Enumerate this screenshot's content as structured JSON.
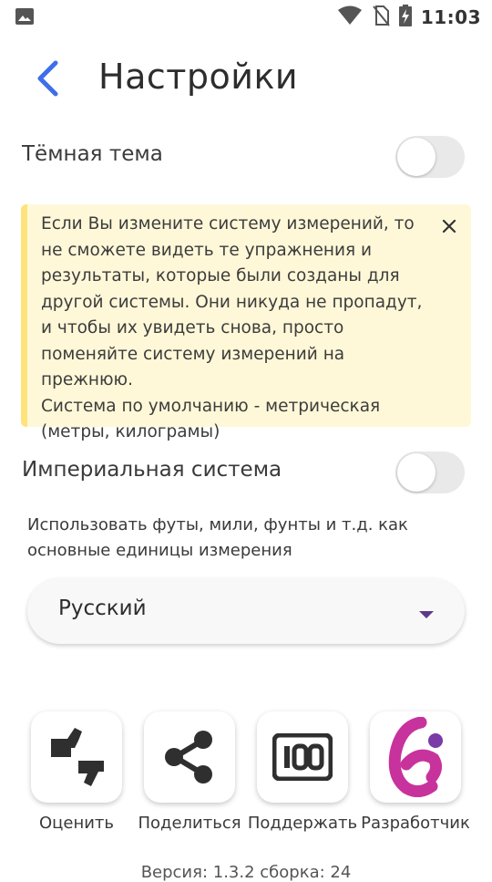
{
  "status_bar": {
    "time": "11:03",
    "icons": [
      "image-icon",
      "wifi-icon",
      "no-sim-icon",
      "battery-charging-icon"
    ]
  },
  "header": {
    "back_icon": "chevron-left-icon",
    "title": "Настройки"
  },
  "dark_theme": {
    "label": "Тёмная тема",
    "enabled": false
  },
  "notice": {
    "text": "Если Вы измените систему измерений, то не сможете видеть те упражнения и результаты, которые были созданы для другой системы. Они никуда не пропадут, и чтобы их увидеть снова, просто поменяйте систему измерений на прежнюю.\nСистема по умолчанию - метрическая (метры, килограмы)",
    "close_icon": "close-icon"
  },
  "imperial": {
    "label": "Империальная система",
    "enabled": false,
    "description": "Использовать футы, мили, фунты и т.д. как основные единицы измерения"
  },
  "language": {
    "selected": "Русский"
  },
  "actions": [
    {
      "label": "Оценить",
      "icon": "thumbs-icon"
    },
    {
      "label": "Поделиться",
      "icon": "share-icon"
    },
    {
      "label": "Поддержать",
      "icon": "support-100-icon"
    },
    {
      "label": "Разработчик",
      "icon": "developer-logo-icon"
    }
  ],
  "version": "Версия: 1.3.2 сборка: 24",
  "colors": {
    "accent_blue": "#3f6fe8",
    "notice_bg": "#fff8d8",
    "notice_bar": "#ffe27a",
    "dropdown_arrow": "#5e3a8a",
    "developer_logo": "#c8329c"
  }
}
